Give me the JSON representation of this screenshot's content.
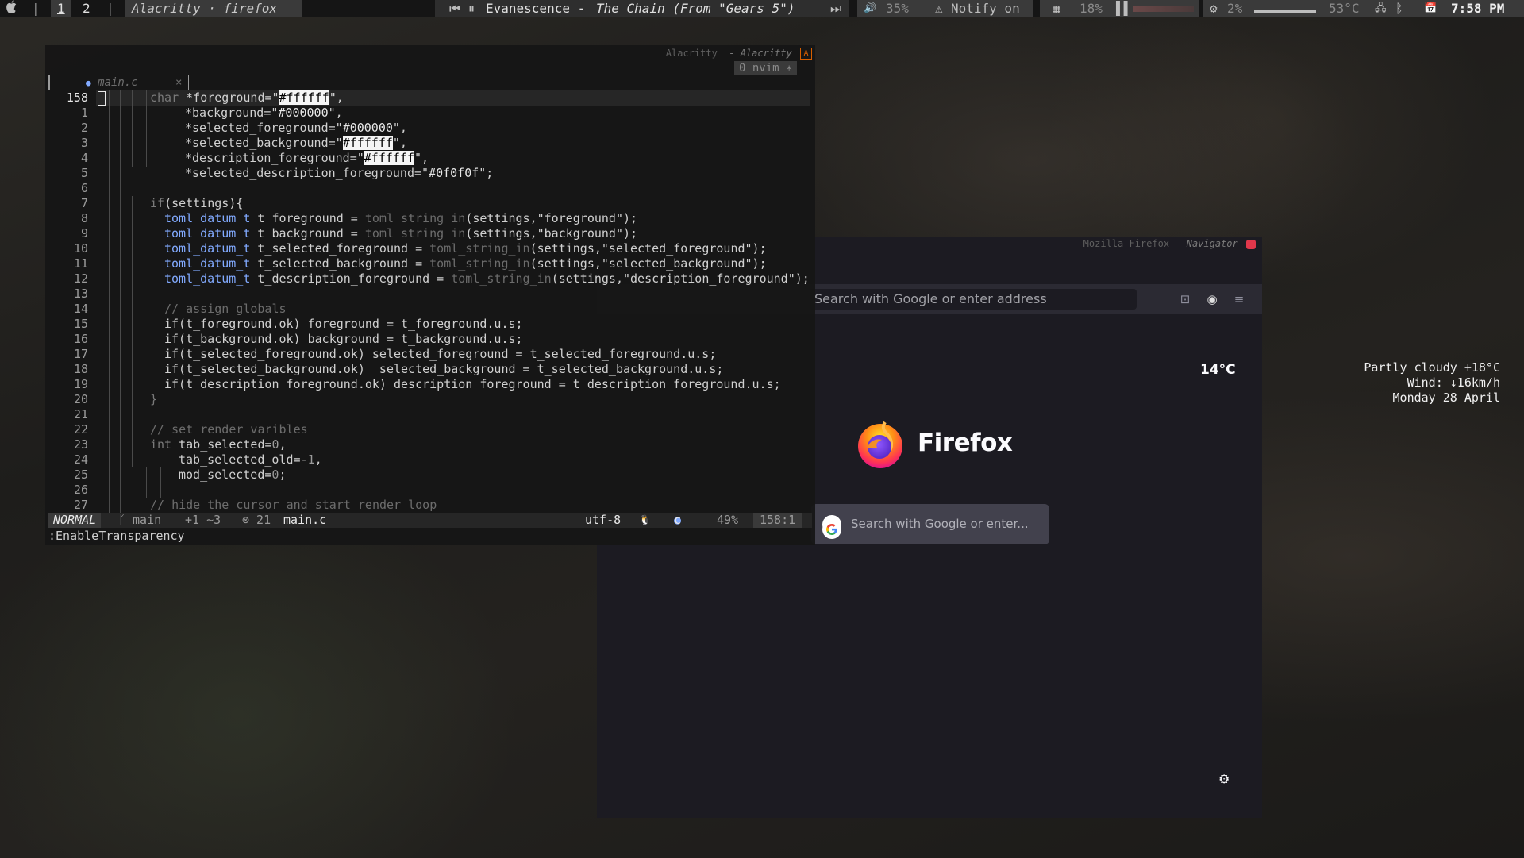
{
  "topbar": {
    "apple": "",
    "sep1": "|",
    "ws1": "1",
    "ws2": "2",
    "sep2": "|",
    "window_title": "Alacritty · firefox",
    "media_prev": "⏮",
    "media_pause": "⏸",
    "now_playing_artist": "Evanescence - ",
    "now_playing_title": "The Chain (From \"Gears 5\")",
    "media_next": "⏭",
    "volume_icon": "🔊",
    "volume": "35%",
    "notify_icon": "⚠",
    "notify": "Notify on",
    "ram_icon": "▦",
    "ram": "18%",
    "cpu_graph": "▌▌",
    "cpu_icon": "⚙",
    "cpu": "2%",
    "temp": "53°C",
    "net_icon": "🖧",
    "bluetooth_icon": "ᛒ",
    "calendar_icon": "📅",
    "time": "7:58 PM"
  },
  "alacritty": {
    "title_app": "Alacritty",
    "title_class": "- Alacritty",
    "close_label": "A",
    "nvim_tag": "0 nvim ∗",
    "tab_label": "main.c",
    "tab_close": "×",
    "lines": [
      {
        "n": "158"
      },
      {
        "n": "1"
      },
      {
        "n": "2"
      },
      {
        "n": "3"
      },
      {
        "n": "4"
      },
      {
        "n": "5"
      },
      {
        "n": "6"
      },
      {
        "n": "7"
      },
      {
        "n": "8"
      },
      {
        "n": "9"
      },
      {
        "n": "10"
      },
      {
        "n": "11"
      },
      {
        "n": "12"
      },
      {
        "n": "13"
      },
      {
        "n": "14"
      },
      {
        "n": "15"
      },
      {
        "n": "16"
      },
      {
        "n": "17"
      },
      {
        "n": "18"
      },
      {
        "n": "19"
      },
      {
        "n": "20"
      },
      {
        "n": "21"
      },
      {
        "n": "22"
      },
      {
        "n": "23"
      },
      {
        "n": "24"
      },
      {
        "n": "25"
      },
      {
        "n": "26"
      },
      {
        "n": "27"
      }
    ],
    "code": {
      "l0a": "char ",
      "l0b": "*foreground=\"",
      "l0c": "#ffffff",
      "l0d": "\",",
      "l1a": "*background=\"",
      "l1b": "#000000",
      "l1c": "\",",
      "l2a": "*selected_foreground=\"",
      "l2b": "#000000",
      "l2c": "\",",
      "l3a": "*selected_background=\"",
      "l3b": "#ffffff",
      "l3c": "\",",
      "l4a": "*description_foreground=\"",
      "l4b": "#ffffff",
      "l4c": "\",",
      "l5a": "*selected_description_foreground=\"",
      "l5b": "#0f0f0f",
      "l5c": "\";",
      "l7a": "if",
      "l7b": "(settings){",
      "l8a": "toml_datum_t",
      "l8b": " t_foreground = ",
      "l8c": "toml_string_in",
      "l8d": "(settings,\"foreground\");",
      "l9a": "toml_datum_t",
      "l9b": " t_background = ",
      "l9c": "toml_string_in",
      "l9d": "(settings,\"background\");",
      "l10a": "toml_datum_t",
      "l10b": " t_selected_foreground = ",
      "l10c": "toml_string_in",
      "l10d": "(settings,\"selected_foreground\");",
      "l11a": "toml_datum_t",
      "l11b": " t_selected_background = ",
      "l11c": "toml_string_in",
      "l11d": "(settings,\"selected_background\");",
      "l12a": "toml_datum_t",
      "l12b": " t_description_foreground = ",
      "l12c": "toml_string_in",
      "l12d": "(settings,\"description_foreground\");",
      "l14": "// assign globals",
      "l15": "if(t_foreground.ok) foreground = t_foreground.u.s;",
      "l16": "if(t_background.ok) background = t_background.u.s;",
      "l17": "if(t_selected_foreground.ok) selected_foreground = t_selected_foreground.u.s;",
      "l18": "if(t_selected_background.ok)  selected_background = t_selected_background.u.s;",
      "l19": "if(t_description_foreground.ok) description_foreground = t_description_foreground.u.s;",
      "l20": "}",
      "l22": "// set render varibles",
      "l23a": "int",
      "l23b": " tab_selected=",
      "l23c": "0",
      "l23d": ",",
      "l24a": "tab_selected_old=",
      "l24b": "-1",
      "l24c": ",",
      "l25a": "mod_selected=",
      "l25b": "0",
      "l25c": ";",
      "l27": "// hide the cursor and start render loop"
    },
    "status": {
      "mode": "NORMAL",
      "branch": "ᚴ main",
      "diff": "+1 ~3",
      "diag": "⊗ 21",
      "file": "main.c",
      "encoding": "utf-8",
      "os_icon": "🐧",
      "ft_icon": "c",
      "percent": "49%",
      "position": "158:1"
    },
    "cmdline": ":EnableTransparency"
  },
  "firefox": {
    "title_app": "Mozilla Firefox",
    "title_class": "- Navigator",
    "url_placeholder": "Search with Google or enter address",
    "weather": "14°C",
    "wordmark": "Firefox",
    "search_placeholder": "Search with Google or enter...",
    "google_letter": "G",
    "icon_pocket": "⊡",
    "icon_account": "◉",
    "icon_menu": "≡",
    "icon_settings": "⚙"
  },
  "desktop_weather": {
    "line1": "Partly cloudy +18°C",
    "line2": "Wind: ↓16km/h",
    "line3": "Monday 28 April"
  },
  "colors": {
    "bar_bg": "#151515",
    "terminal_bg": "#161616",
    "firefox_bg": "#1c1b22",
    "accent_blue": "#82aaff",
    "close_orange": "#d75f00",
    "ff_close_red": "#e0374b"
  }
}
